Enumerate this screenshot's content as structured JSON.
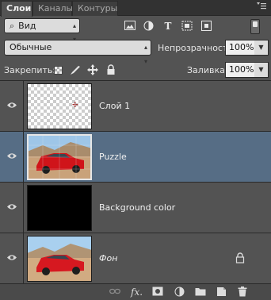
{
  "tabs": [
    {
      "label": "Слои",
      "active": true
    },
    {
      "label": "Каналы",
      "active": false
    },
    {
      "label": "Контуры",
      "active": false
    }
  ],
  "panel_menu_icon": "panel-menu-icon",
  "filter": {
    "kind_label": "Вид",
    "icons": [
      "image-filter-icon",
      "adjustment-filter-icon",
      "type-filter-icon",
      "shape-filter-icon",
      "smart-object-filter-icon"
    ]
  },
  "blend": {
    "mode": "Обычные",
    "opacity_label": "Непрозрачность:",
    "opacity_value": "100%"
  },
  "lock": {
    "label": "Закрепить:",
    "icons": [
      "lock-transparent-icon",
      "lock-image-icon",
      "lock-position-icon",
      "lock-all-icon"
    ],
    "fill_label": "Заливка:",
    "fill_value": "100%"
  },
  "layers": [
    {
      "name": "Слой 1",
      "thumb": "transparent",
      "selected": false,
      "italic": false,
      "locked": false
    },
    {
      "name": "Puzzle",
      "thumb": "car-photo",
      "selected": true,
      "italic": false,
      "locked": false
    },
    {
      "name": "Background color",
      "thumb": "black",
      "selected": false,
      "italic": false,
      "locked": false
    },
    {
      "name": "Фон",
      "thumb": "car-photo",
      "selected": false,
      "italic": true,
      "locked": true
    }
  ],
  "bottom_icons": [
    "link-layers-icon",
    "fx-icon",
    "layer-mask-icon",
    "adjustment-layer-icon",
    "group-folder-icon",
    "new-layer-icon",
    "trash-icon"
  ],
  "colors": {
    "panel_bg": "#535353",
    "selected_row": "#566d85",
    "tab_bar": "#323232"
  }
}
